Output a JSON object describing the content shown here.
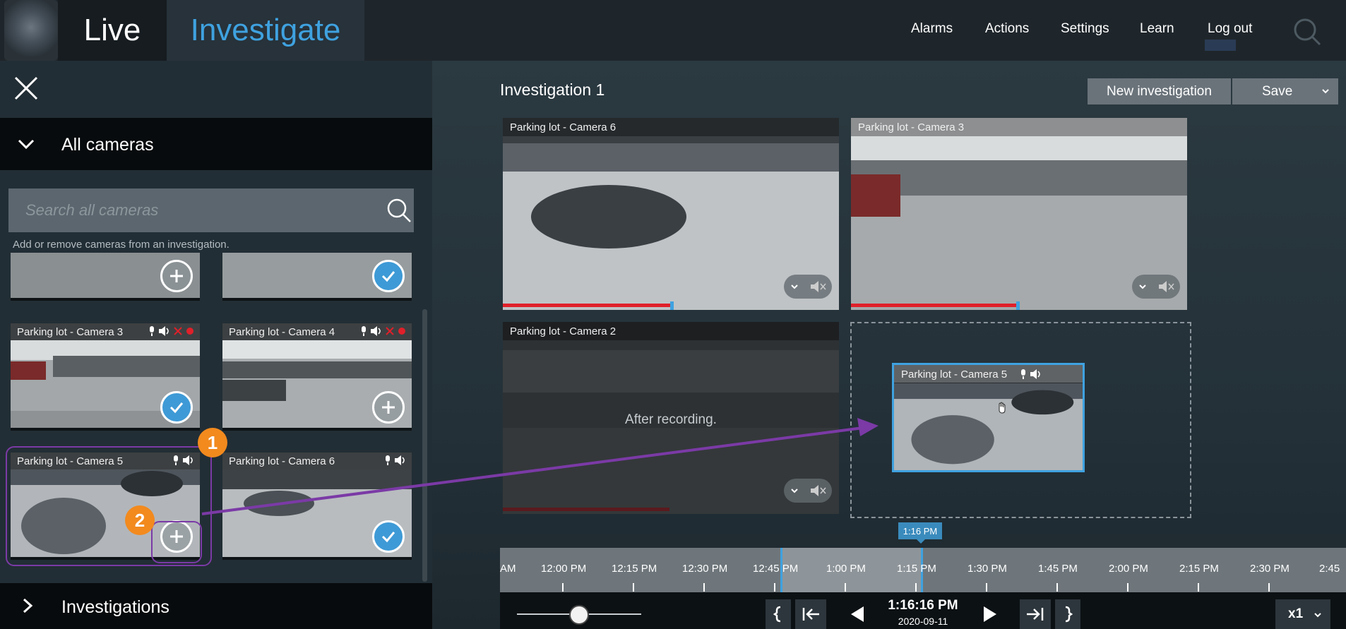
{
  "nav": {
    "live": "Live",
    "investigate": "Investigate",
    "menu": [
      "Alarms",
      "Actions",
      "Settings",
      "Learn",
      "Log out"
    ]
  },
  "left": {
    "all_cameras": "All cameras",
    "search_placeholder": "Search all cameras",
    "hint": "Add or remove cameras from an investigation.",
    "cameras": [
      {
        "name": "",
        "state": "add"
      },
      {
        "name": "",
        "state": "checked"
      },
      {
        "name": "Parking lot - Camera 3",
        "state": "checked"
      },
      {
        "name": "Parking lot - Camera 4",
        "state": "add"
      },
      {
        "name": "Parking lot - Camera 5",
        "state": "add"
      },
      {
        "name": "Parking lot - Camera 6",
        "state": "checked"
      }
    ],
    "badge1": "1",
    "badge2": "2",
    "investigations": "Investigations"
  },
  "main": {
    "title": "Investigation 1",
    "new_investigation": "New investigation",
    "save": "Save",
    "tiles": [
      {
        "name": "Parking lot - Camera 6"
      },
      {
        "name": "Parking lot - Camera 3"
      },
      {
        "name": "Parking lot - Camera 2",
        "status": "After recording."
      }
    ],
    "drag_tile": "Parking lot - Camera 5"
  },
  "timeline": {
    "labels": [
      "AM",
      "12:00 PM",
      "12:15 PM",
      "12:30 PM",
      "12:45 PM",
      "1:00 PM",
      "1:15 PM",
      "1:30 PM",
      "1:45 PM",
      "2:00 PM",
      "2:15 PM",
      "2:30 PM",
      "2:45"
    ],
    "cursor": "1:16 PM",
    "current_time": "1:16:16 PM",
    "current_date": "2020-09-11",
    "speed": "x1"
  },
  "colors": {
    "accent": "#3fa2e0",
    "annotation": "#7b3aa6",
    "badge": "#f28a1e",
    "recording": "#e0202a"
  }
}
